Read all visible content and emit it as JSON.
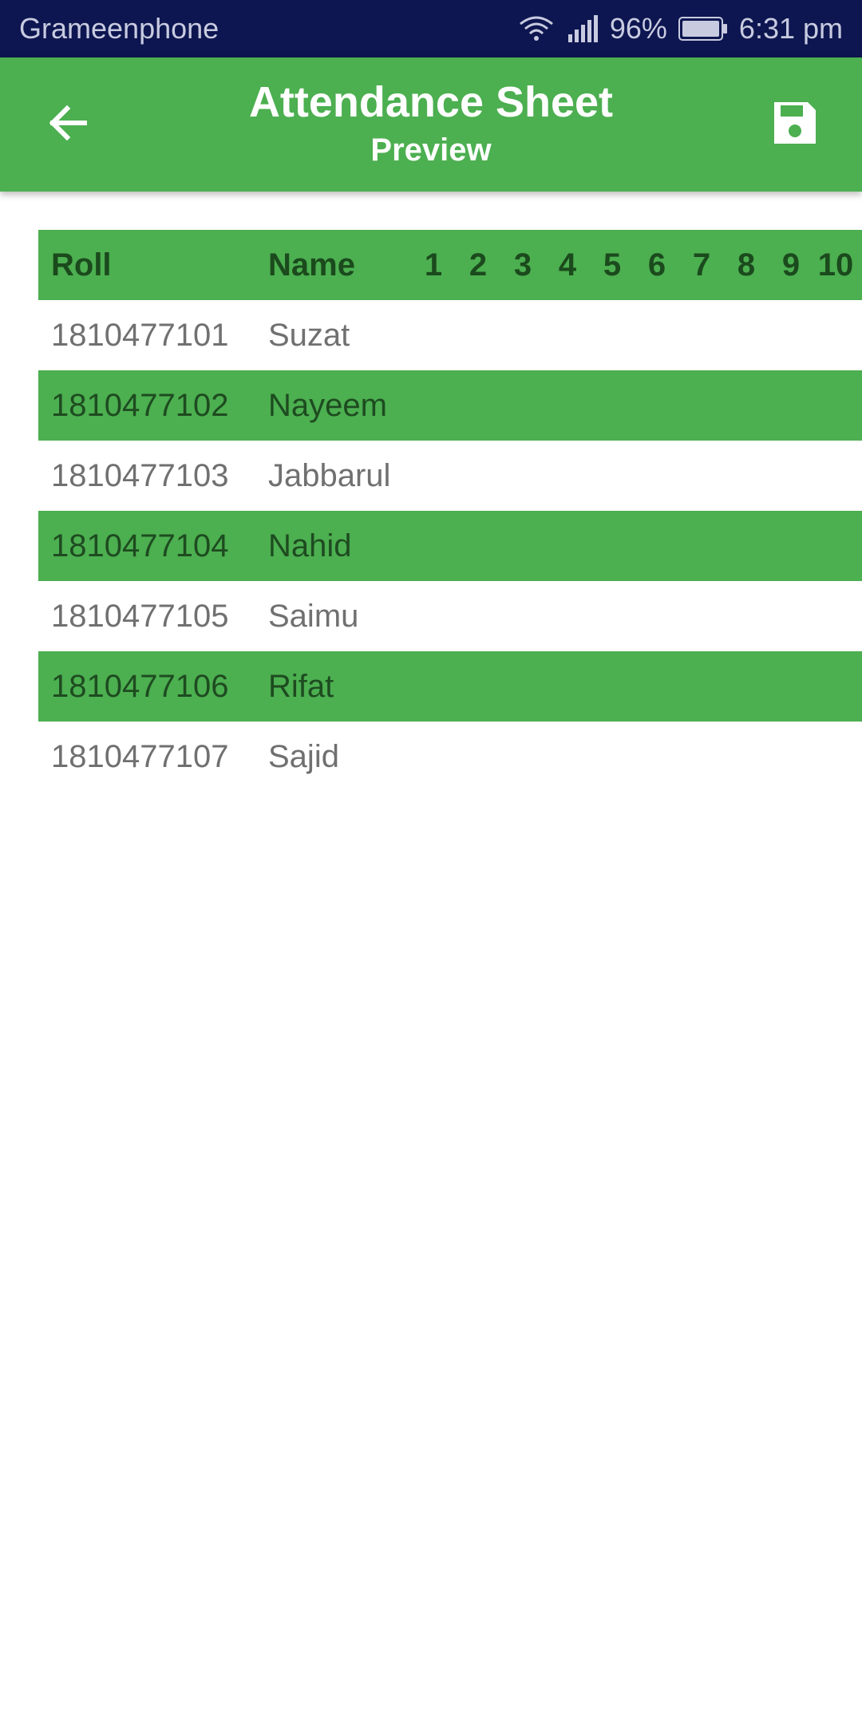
{
  "status_bar": {
    "carrier": "Grameenphone",
    "battery": "96%",
    "time": "6:31 pm",
    "icons": [
      "wifi-icon",
      "signal-icon",
      "battery-icon"
    ]
  },
  "app_bar": {
    "title": "Attendance Sheet",
    "subtitle": "Preview",
    "back_icon": "arrow-left-icon",
    "save_icon": "floppy-disk-icon",
    "color": "#4caf50"
  },
  "table": {
    "headers": {
      "roll": "Roll",
      "name": "Name",
      "days": [
        "1",
        "2",
        "3",
        "4",
        "5",
        "6",
        "7",
        "8",
        "9",
        "10"
      ]
    },
    "rows": [
      {
        "roll": "1810477101",
        "name": "Suzat"
      },
      {
        "roll": "1810477102",
        "name": "Nayeem"
      },
      {
        "roll": "1810477103",
        "name": "Jabbarul"
      },
      {
        "roll": "1810477104",
        "name": "Nahid"
      },
      {
        "roll": "1810477105",
        "name": "Saimu"
      },
      {
        "roll": "1810477106",
        "name": "Rifat"
      },
      {
        "roll": "1810477107",
        "name": "Sajid"
      }
    ]
  }
}
